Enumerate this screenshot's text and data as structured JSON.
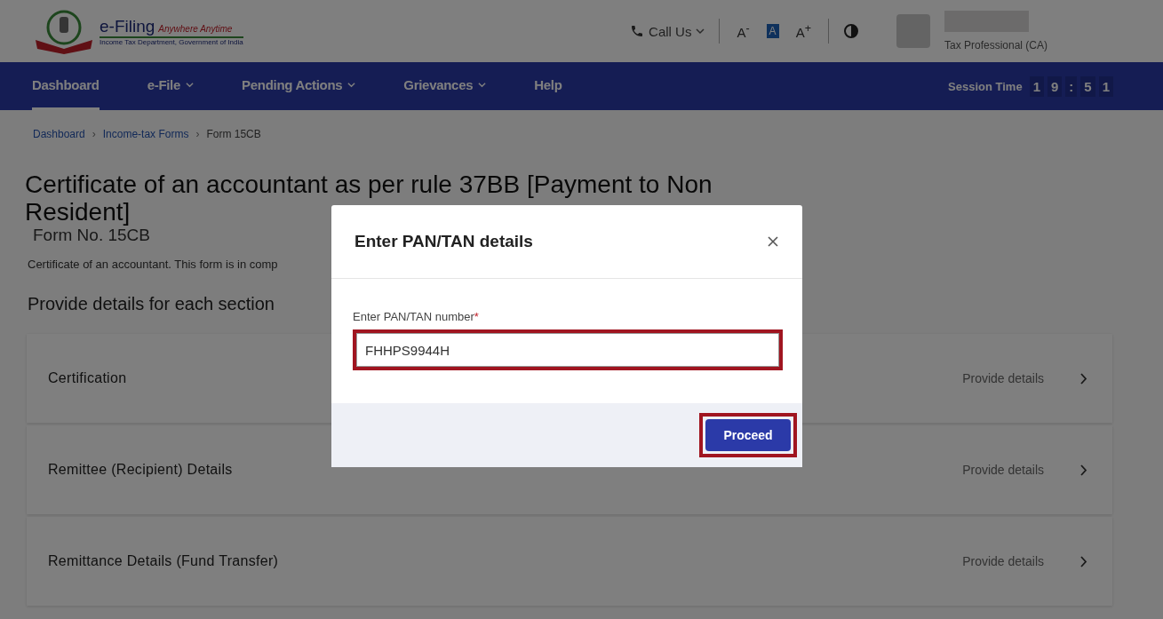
{
  "header": {
    "logo_title": "e-Filing",
    "logo_tagline": "Anywhere Anytime",
    "logo_subtitle": "Income Tax Department, Government of India",
    "call_us": "Call Us",
    "font_controls": [
      {
        "label": "A$^{-}$",
        "selected": false
      },
      {
        "label": "A",
        "selected": true
      },
      {
        "label": "A$^{+}$",
        "selected": false
      }
    ],
    "user_role": "Tax Professional (CA)"
  },
  "nav": {
    "items": [
      {
        "label": "Dashboard",
        "selected": true,
        "has_menu": false
      },
      {
        "label": "e-File",
        "selected": false,
        "has_menu": true
      },
      {
        "label": "Pending Actions",
        "selected": false,
        "has_menu": true
      },
      {
        "label": "Grievances",
        "selected": false,
        "has_menu": true
      },
      {
        "label": "Help",
        "selected": false,
        "has_menu": false
      }
    ],
    "session_label": "Session Time",
    "session_digits": [
      "1",
      "9",
      ":",
      "5",
      "1"
    ]
  },
  "breadcrumb": [
    {
      "label": "Dashboard",
      "link": true,
      "separator": "›"
    },
    {
      "label": "Income-tax Forms",
      "link": true,
      "separator": "›"
    },
    {
      "label": "Form 15CB",
      "link": false
    }
  ],
  "page": {
    "title": "Certificate of an accountant as per rule 37BB [Payment to Non Resident]",
    "form_no": "Form No. 15CB",
    "description": "Certificate of an accountant. This form is in comp",
    "sections_heading": "Provide details for each section"
  },
  "sections": [
    {
      "title": "Certification",
      "action": "Provide details"
    },
    {
      "title": "Remittee (Recipient) Details",
      "action": "Provide details"
    },
    {
      "title": "Remittance Details (Fund Transfer)",
      "action": "Provide details"
    }
  ],
  "dialog": {
    "title": "Enter PAN/TAN details",
    "field_label": "Enter PAN/TAN number",
    "required_mark": "*",
    "value": "FHHPS9944H",
    "field_highlighted": true,
    "button": "Proceed",
    "button_highlighted": true
  }
}
